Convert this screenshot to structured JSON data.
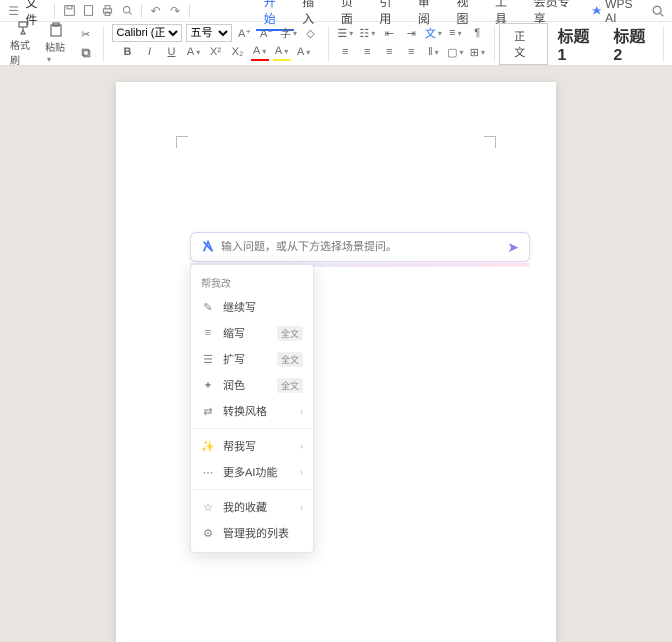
{
  "menubar": {
    "file_label": "文件",
    "tabs": [
      "开始",
      "插入",
      "页面",
      "引用",
      "审阅",
      "视图",
      "工具",
      "会员专享"
    ],
    "active_tab": 0,
    "wps_ai_label": "WPS AI"
  },
  "toolbar": {
    "format_painter": "格式刷",
    "paste": "粘贴",
    "font": "Calibri (正文)",
    "size": "五号",
    "style_body": "正文",
    "style_h1": "标题 1",
    "style_h2": "标题 2"
  },
  "ai": {
    "placeholder": "输入问题，或从下方选择场景提问。",
    "section_edit": "帮我改",
    "items": [
      {
        "icon": "pencil",
        "label": "继续写"
      },
      {
        "icon": "lines-short",
        "label": "缩写",
        "badge": "全文"
      },
      {
        "icon": "lines-long",
        "label": "扩写",
        "badge": "全文"
      },
      {
        "icon": "sparkle",
        "label": "润色",
        "badge": "全文"
      },
      {
        "icon": "swap",
        "label": "转换风格",
        "arrow": true
      }
    ],
    "section_write": "帮我写",
    "more_label": "更多AI功能",
    "fav_label": "我的收藏",
    "manage_label": "管理我的列表"
  }
}
